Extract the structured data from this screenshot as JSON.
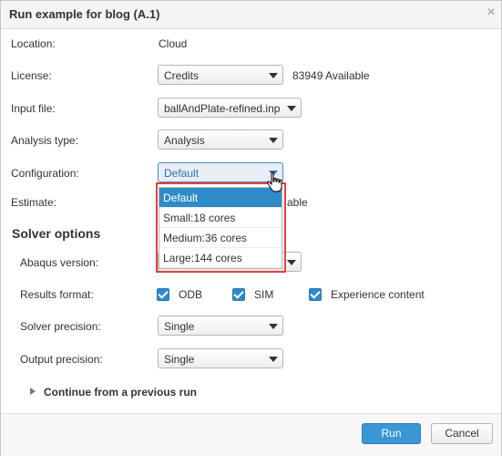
{
  "dialog": {
    "title": "Run example for blog (A.1)",
    "close_glyph": "×"
  },
  "fields": {
    "location": {
      "label": "Location:",
      "value": "Cloud"
    },
    "license": {
      "label": "License:",
      "value": "Credits",
      "available": "83949 Available"
    },
    "input_file": {
      "label": "Input file:",
      "value": "ballAndPlate-refined.inp"
    },
    "analysis_type": {
      "label": "Analysis type:",
      "value": "Analysis"
    },
    "configuration": {
      "label": "Configuration:",
      "value": "Default"
    },
    "estimate": {
      "label": "Estimate:",
      "partial_text": "able"
    }
  },
  "configuration_dropdown": {
    "options": [
      "Default",
      "Small:18 cores",
      "Medium:36 cores",
      "Large:144 cores"
    ],
    "selected": "Default"
  },
  "solver_options": {
    "title": "Solver options",
    "abaqus_version": {
      "label": "Abaqus version:"
    },
    "results_format": {
      "label": "Results format:",
      "options": [
        {
          "label": "ODB",
          "checked": true
        },
        {
          "label": "SIM",
          "checked": true
        },
        {
          "label": "Experience content",
          "checked": true
        }
      ]
    },
    "solver_precision": {
      "label": "Solver precision:",
      "value": "Single"
    },
    "output_precision": {
      "label": "Output precision:",
      "value": "Single"
    }
  },
  "continue_section": {
    "label": "Continue from a previous run"
  },
  "footer": {
    "run_label": "Run",
    "cancel_label": "Cancel"
  },
  "colors": {
    "primary": "#3a97d6",
    "highlight": "#e4413f",
    "selection": "#2f8bc7"
  }
}
